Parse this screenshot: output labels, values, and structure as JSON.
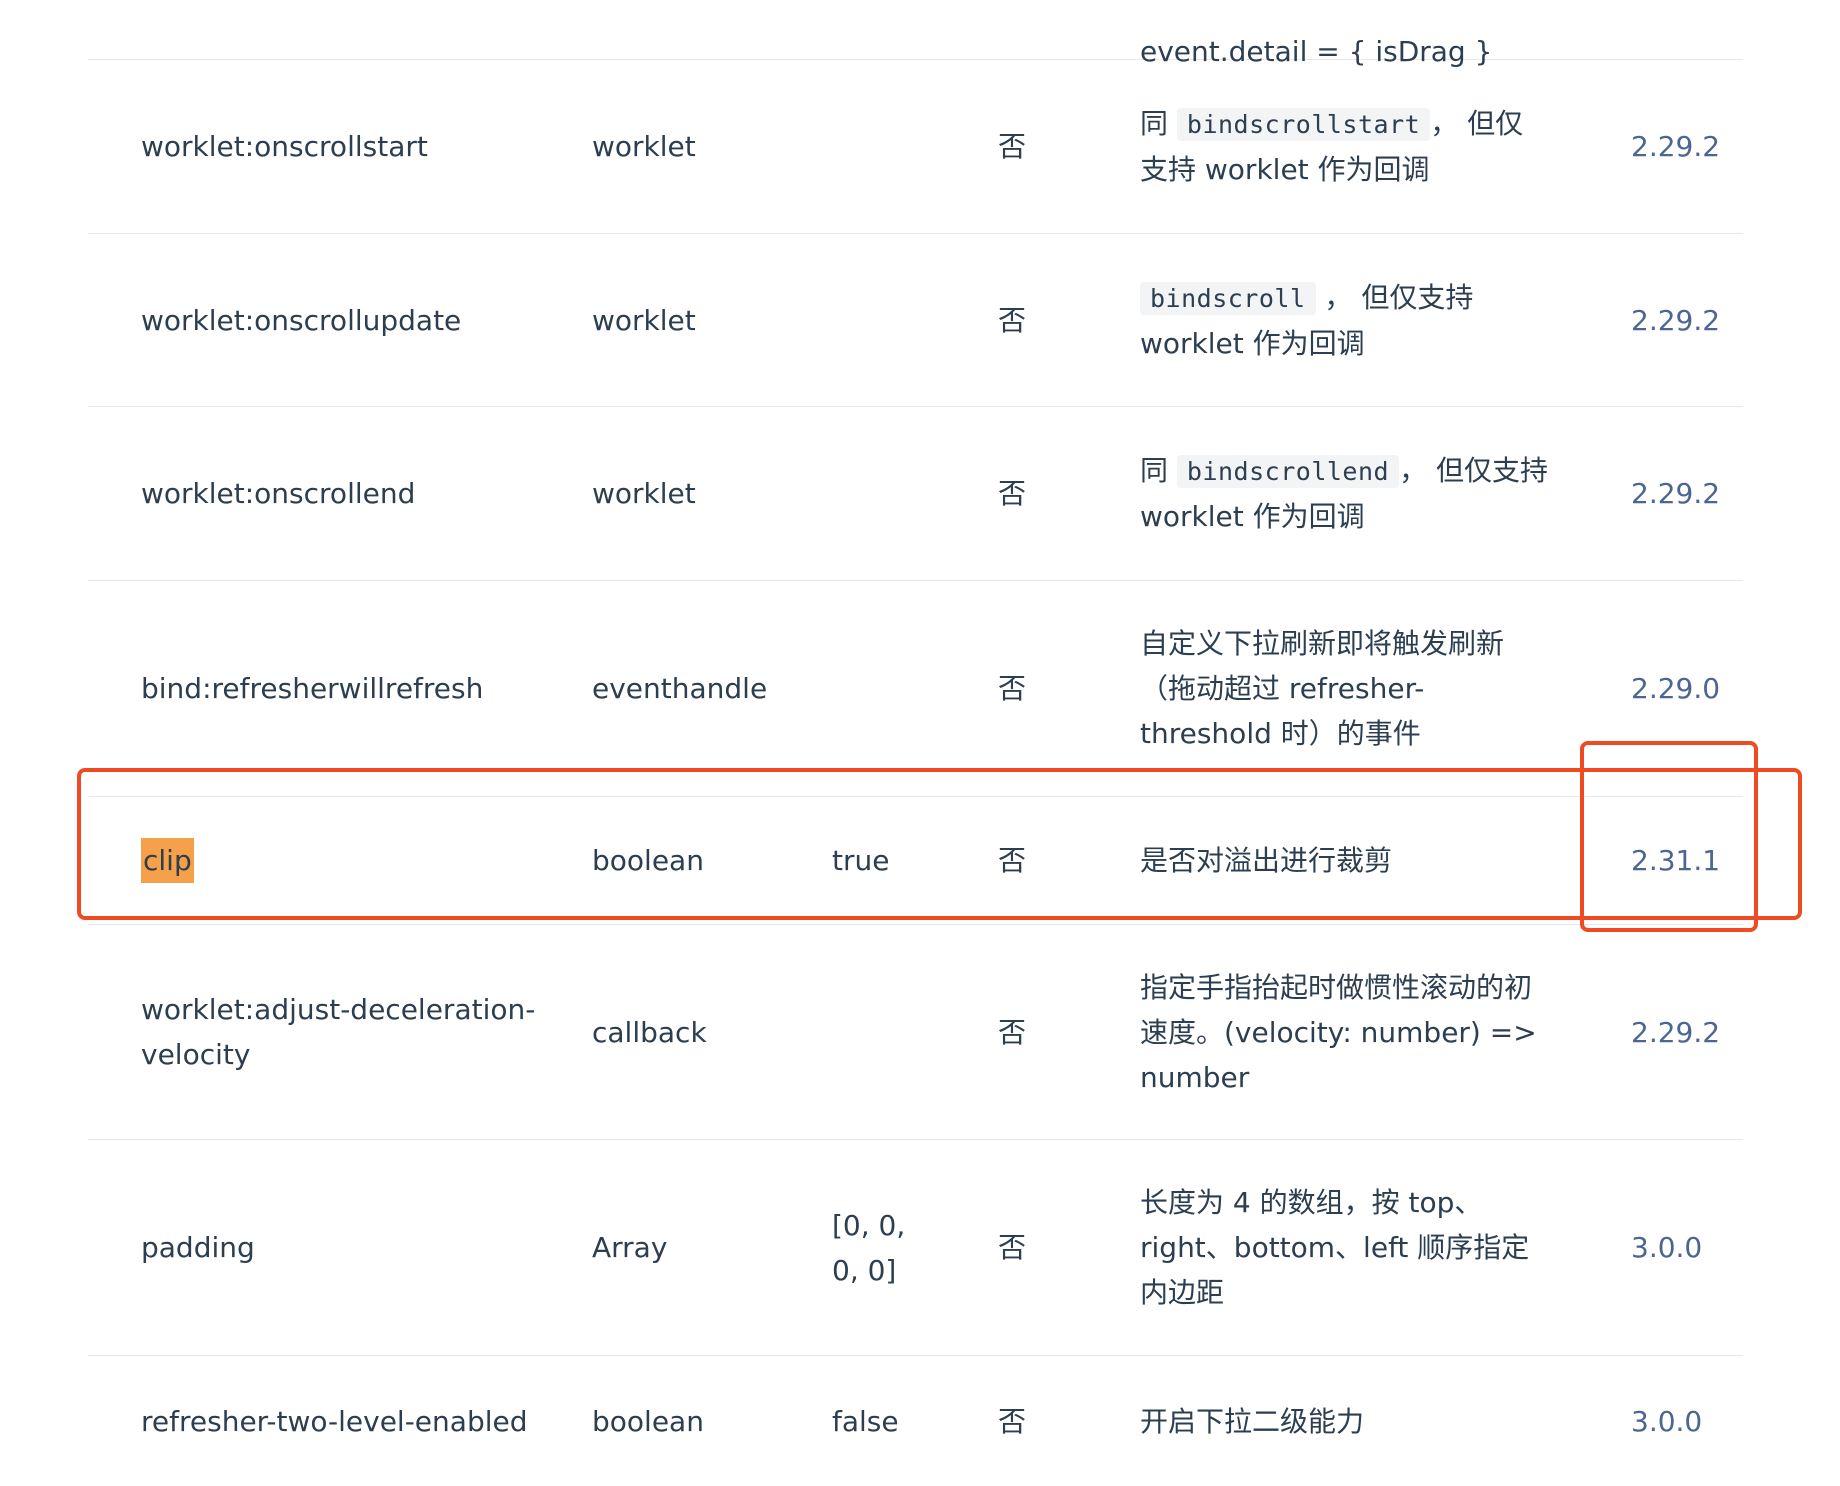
{
  "top_partial_text": "event.detail = { isDrag }",
  "rows": [
    {
      "name": "worklet:onscrollstart",
      "type": "worklet",
      "default": "",
      "required": "否",
      "desc_pre": "同 ",
      "desc_code": "bindscrollstart",
      "desc_post": "， 但仅支持 worklet 作为回调",
      "version": "2.29.2"
    },
    {
      "name": "worklet:onscrollupdate",
      "type": "worklet",
      "default": "",
      "required": "否",
      "desc_pre": "",
      "desc_code": "bindscroll",
      "desc_post": " ， 但仅支持 worklet 作为回调",
      "version": "2.29.2"
    },
    {
      "name": "worklet:onscrollend",
      "type": "worklet",
      "default": "",
      "required": "否",
      "desc_pre": "同 ",
      "desc_code": "bindscrollend",
      "desc_post": "， 但仅支持 worklet 作为回调",
      "version": "2.29.2"
    },
    {
      "name": "bind:refresherwillrefresh",
      "type": "eventhandle",
      "default": "",
      "required": "否",
      "desc": "自定义下拉刷新即将触发刷新（拖动超过 refresher-threshold 时）的事件",
      "version": "2.29.0"
    },
    {
      "name": "clip",
      "type": "boolean",
      "default": "true",
      "required": "否",
      "desc": "是否对溢出进行裁剪",
      "version": "2.31.1"
    },
    {
      "name": "worklet:adjust-deceleration-velocity",
      "type": "callback",
      "default": "",
      "required": "否",
      "desc": "指定手指抬起时做惯性滚动的初速度。(velocity: number) => number",
      "version": "2.29.2"
    },
    {
      "name": "padding",
      "type": "Array",
      "default": "[0, 0, 0, 0]",
      "required": "否",
      "desc": "长度为 4 的数组，按 top、right、bottom、left 顺序指定内边距",
      "version": "3.0.0"
    },
    {
      "name": "refresher-two-level-enabled",
      "type": "boolean",
      "default": "false",
      "required": "否",
      "desc": "开启下拉二级能力",
      "version": "3.0.0"
    }
  ],
  "colors": {
    "annotation_red": "#f04a23",
    "highlight_orange": "#f5a14a",
    "version_link": "#4d6592",
    "text": "#2c3e50"
  }
}
